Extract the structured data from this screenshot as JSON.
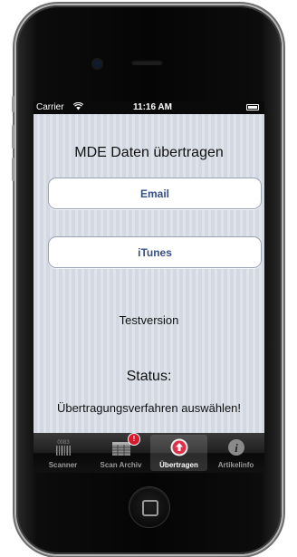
{
  "status_bar": {
    "carrier": "Carrier",
    "time": "11:16 AM"
  },
  "screen": {
    "title": "MDE Daten übertragen",
    "email_button": "Email",
    "itunes_button": "iTunes",
    "version": "Testversion",
    "status_label": "Status:",
    "status_text": "Übertragungsverfahren auswählen!"
  },
  "tabs": [
    {
      "label": "Scanner",
      "icon": "barcode-icon",
      "active": false
    },
    {
      "label": "Scan Archiv",
      "icon": "table-icon",
      "active": false,
      "badge": "!"
    },
    {
      "label": "Übertragen",
      "icon": "upload-icon",
      "active": true
    },
    {
      "label": "Artikelinfo",
      "icon": "info-icon",
      "active": false
    }
  ],
  "colors": {
    "button_text": "#354f86",
    "badge": "#d8192c",
    "active_tab_icon": "#e0314a"
  }
}
